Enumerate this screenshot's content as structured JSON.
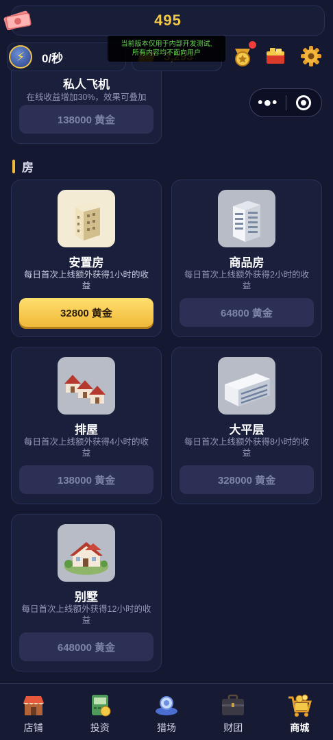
{
  "hud": {
    "gold_total": "495",
    "speed": "0/秒",
    "gold_amount": "3,293",
    "notice_line1": "当前版本仅用于内部开发测试,",
    "notice_line2": "所有内容均不面向用户"
  },
  "top_card": {
    "title": "私人飞机",
    "desc": "在线收益增加30%，效果可叠加",
    "price": "138000 黄金"
  },
  "section": {
    "name": "房"
  },
  "cards": [
    {
      "title": "安置房",
      "desc": "每日首次上线额外获得1小时的收益",
      "price": "32800 黄金",
      "active": true
    },
    {
      "title": "商品房",
      "desc": "每日首次上线额外获得2小时的收益",
      "price": "64800 黄金",
      "active": false
    },
    {
      "title": "排屋",
      "desc": "每日首次上线额外获得4小时的收益",
      "price": "138000 黄金",
      "active": false
    },
    {
      "title": "大平层",
      "desc": "每日首次上线额外获得8小时的收益",
      "price": "328000 黄金",
      "active": false
    },
    {
      "title": "别墅",
      "desc": "每日首次上线额外获得12小时的收益",
      "price": "648000 黄金",
      "active": false
    }
  ],
  "nav": [
    {
      "label": "店铺",
      "icon": "shop-icon"
    },
    {
      "label": "投资",
      "icon": "invest-icon"
    },
    {
      "label": "猎场",
      "icon": "hunting-icon"
    },
    {
      "label": "财团",
      "icon": "briefcase-icon"
    },
    {
      "label": "商城",
      "icon": "store-cart-icon",
      "active": true
    }
  ],
  "colors": {
    "gold": "#f3c94a",
    "bg": "#141830",
    "card": "#1a1f3c",
    "notice_text": "#63d64e"
  }
}
